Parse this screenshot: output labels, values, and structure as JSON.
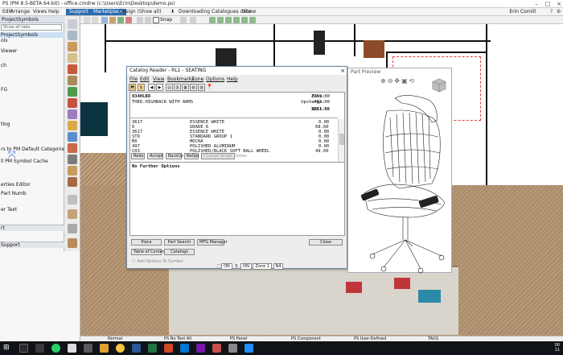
{
  "app": {
    "title": "PS (PM 8.5-BETA 64-bit) - office.cmdrw (c:\\Users\\Erin\\Desktop\\demo.ps)",
    "menu": [
      "Edit",
      "Arrange",
      "Views",
      "Help"
    ],
    "support_label": "Support",
    "marketplace_label": "Marketplace",
    "design_label": "Design (Show all)",
    "downloading_label": "Downloading Catalogues data",
    "show_label": "Show",
    "user": "Erin Cornill"
  },
  "left_panel": {
    "title": "ProjectSymbols",
    "search_placeholder": "Show all tabs",
    "items": [
      "ProjectSymbols",
      "ols",
      "Viewer",
      "ch",
      "FG",
      "tlog",
      "rs to PM Default Categories",
      "ll PM Symbol Cache",
      "erties Editor",
      "Part Numb",
      "er Text"
    ],
    "sections": [
      "rt",
      "Support"
    ]
  },
  "toolbar": {
    "snap_label": "Snap"
  },
  "catalog_reader": {
    "title": "Catalog Reader - RL1 - SEATING",
    "menu": [
      "File",
      "Edit",
      "View",
      "Bookmarks",
      "Zone",
      "Options",
      "Help"
    ],
    "part_code": "834HLB8",
    "part_desc": "THED.HIGHBACK WITH ARMS",
    "base_label": "Base:",
    "base_value": "2769.00",
    "upcharge_label": "Upcharge:",
    "upcharge_value": "482.00",
    "unit_label": "Unit:",
    "unit_value": "3251.00",
    "options": [
      {
        "code": "3617",
        "desc": "ESSENCE WHITE",
        "price": "0.00"
      },
      {
        "code": "6",
        "desc": "GRADE 6",
        "price": "68.00"
      },
      {
        "code": "3617",
        "desc": "ESSENCE WHITE",
        "price": "0.00"
      },
      {
        "code": "STD",
        "desc": "STANDARD GROUP 1",
        "price": "0.00"
      },
      {
        "code": "MX",
        "desc": "MOCHA",
        "price": "0.00"
      },
      {
        "code": "497",
        "desc": "POLISHED ALUMINUM",
        "price": "0.00"
      },
      {
        "code": "C03",
        "desc": "POLISHED/BLACK SOFT BALL WHEEL",
        "price": "49.00"
      }
    ],
    "buttons": [
      "Redo",
      "Accept",
      "BackUp",
      "ReOpt",
      "Change Single Option"
    ],
    "no_further": "No Further Options",
    "bottom_buttons": [
      "Place",
      "Part Search",
      "MFG Manager",
      "Close"
    ],
    "bottom_buttons2": [
      "Table of Contents",
      "Catalogs"
    ],
    "add_options": "Add Options To Symbol"
  },
  "preview": {
    "title": "Part Preview"
  },
  "osnap": {
    "on1": "ON",
    "s": "S",
    "on2": "ON",
    "zone": "Zone 1",
    "n": "N4"
  },
  "status": [
    "Normal",
    "PS No Text All",
    "PS Panel",
    "PS Component",
    "PS User-Defined",
    "TAGS"
  ],
  "clock": {
    "time": "00",
    "date": "11"
  }
}
